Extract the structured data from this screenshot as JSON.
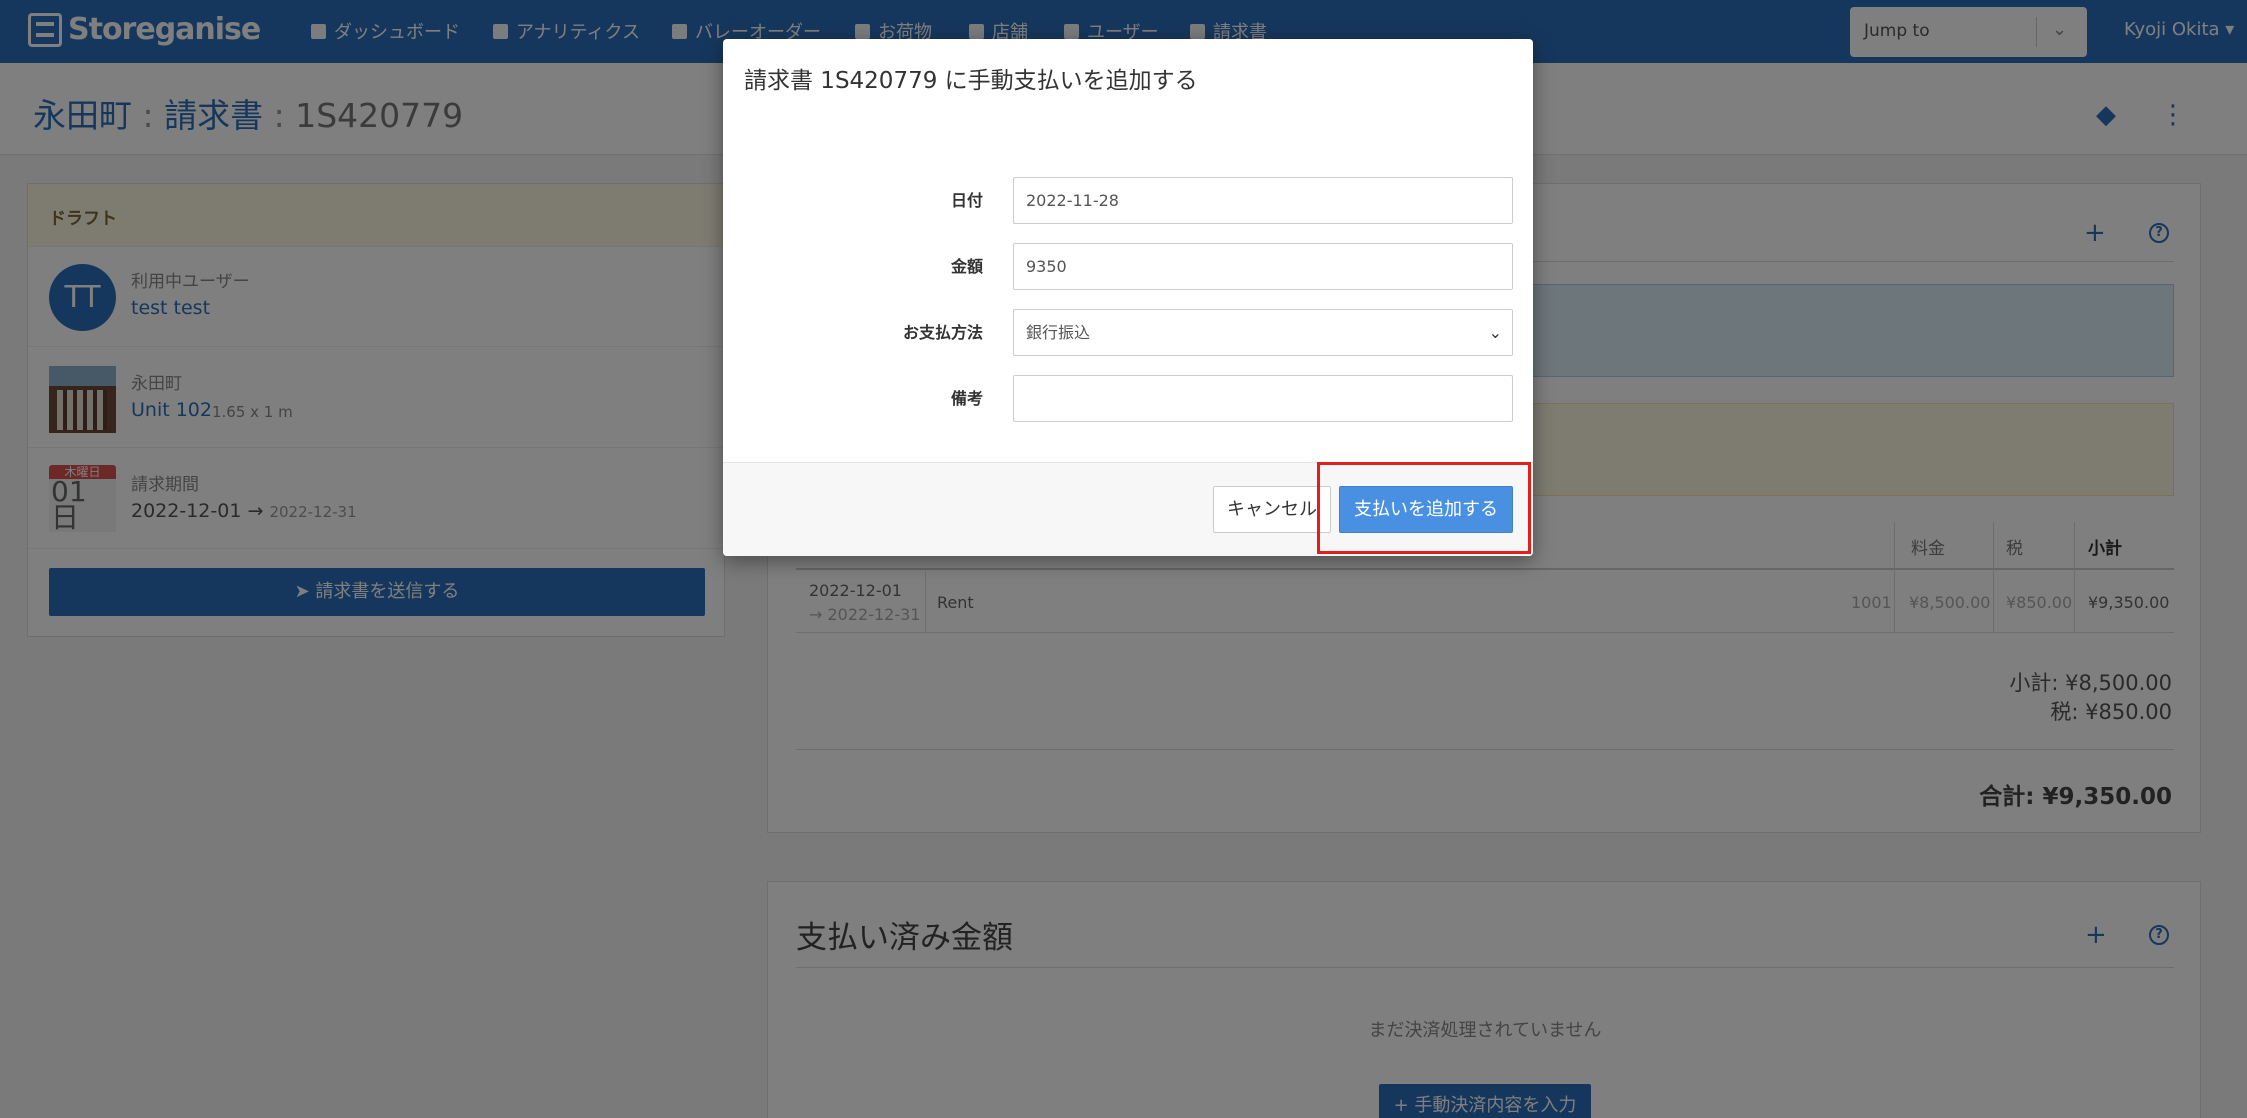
{
  "nav": {
    "brand": "Storeganise",
    "items": [
      {
        "label": "ダッシュボード",
        "icon": "sitemap-icon"
      },
      {
        "label": "アナリティクス",
        "icon": "chart-icon"
      },
      {
        "label": "バレーオーダー",
        "icon": "truck-icon"
      },
      {
        "label": "お荷物",
        "icon": "archive-icon"
      },
      {
        "label": "店舗",
        "icon": "building-icon"
      },
      {
        "label": "ユーザー",
        "icon": "user-icon"
      },
      {
        "label": "請求書",
        "icon": "file-icon"
      }
    ],
    "jump_placeholder": "Jump to",
    "user_name": "Kyoji Okita"
  },
  "header": {
    "site": "永田町",
    "section": "請求書",
    "invoice_no": "1S420779"
  },
  "left": {
    "status": "ドラフト",
    "user_label": "利用中ユーザー",
    "user_initials": "TT",
    "user_name": "test test",
    "site_label": "永田町",
    "unit_name": "Unit 102",
    "unit_size": "1.65 x 1 m",
    "cal_day": "木曜日",
    "cal_date": "01",
    "cal_date2": "日",
    "period_label": "請求期間",
    "period_start": "2022-12-01",
    "period_arrow": "→",
    "period_end": "2022-12-31",
    "send_button": "請求書を送信する"
  },
  "items": {
    "headers": {
      "fee": "料金",
      "tax": "税",
      "subtotal": "小計"
    },
    "row": {
      "start": "2022-12-01",
      "end": "→ 2022-12-31",
      "desc": "Rent",
      "code": "1001",
      "fee": "¥8,500.00",
      "tax": "¥850.00",
      "subtotal": "¥9,350.00"
    },
    "subtotal_line": "小計: ¥8,500.00",
    "tax_line": "税: ¥850.00",
    "total_line": "合計: ¥9,350.00"
  },
  "paid": {
    "title": "支払い済み金額",
    "empty": "まだ決済処理されていません",
    "manual_button": "手動決済内容を入力"
  },
  "modal": {
    "title": "請求書 1S420779 に手動支払いを追加する",
    "date_label": "日付",
    "date_value": "2022-11-28",
    "amount_label": "金額",
    "amount_value": "9350",
    "method_label": "お支払方法",
    "method_value": "銀行振込",
    "note_label": "備考",
    "note_value": "",
    "cancel": "キャンセル",
    "submit": "支払いを追加する"
  },
  "colors": {
    "primary": "#2d6fba",
    "button": "#4a90e2",
    "highlight": "#e0201b"
  }
}
